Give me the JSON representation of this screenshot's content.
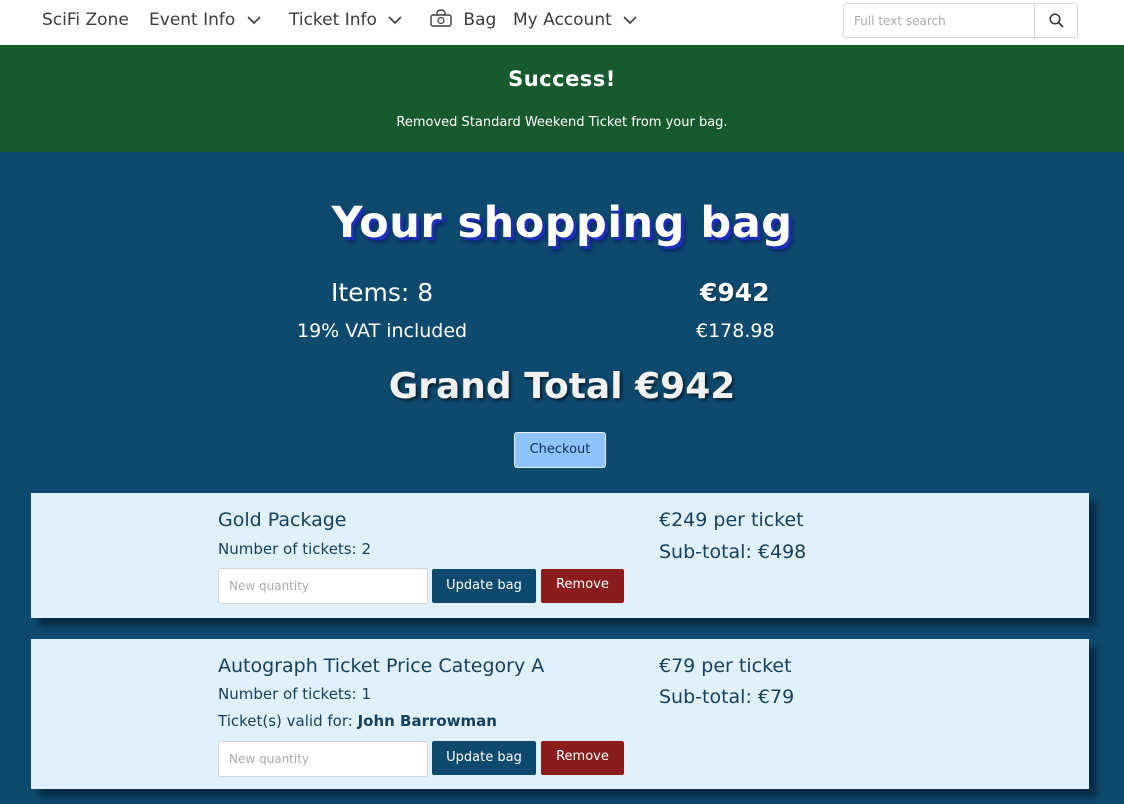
{
  "nav": {
    "brand": "SciFi Zone",
    "event_info": "Event Info",
    "ticket_info": "Ticket Info",
    "bag": "Bag",
    "my_account": "My Account",
    "search_placeholder": "Full text search"
  },
  "alert": {
    "title": "Success!",
    "message": "Removed Standard Weekend Ticket from your bag."
  },
  "summary": {
    "title": "Your shopping bag",
    "items_label": "Items: 8",
    "total": "€942",
    "vat_label": "19% VAT included",
    "vat_amount": "€178.98",
    "grand_total": "Grand Total €942",
    "checkout_label": "Checkout"
  },
  "items": [
    {
      "name": "Gold Package",
      "qty_text": "Number of tickets: 2",
      "price": "€249 per ticket",
      "subtotal": "Sub-total: €498",
      "qty_placeholder": "New quantity",
      "update_label": "Update bag",
      "remove_label": "Remove"
    },
    {
      "name": "Autograph Ticket Price Category A",
      "qty_text": "Number of tickets: 1",
      "valid_label": "Ticket(s) valid for:",
      "valid_name": "John Barrowman",
      "price": "€79 per ticket",
      "subtotal": "Sub-total: €79",
      "qty_placeholder": "New quantity",
      "update_label": "Update bag",
      "remove_label": "Remove"
    }
  ],
  "colors": {
    "page_bg": "#0d4a6e",
    "success_bg": "#165a2e",
    "card_bg": "#e0f1fc",
    "checkout_bg": "#8ec3ff",
    "update_bg": "#0e4a6e",
    "remove_bg": "#8a1c1c"
  },
  "icons": {
    "chevron": "chevron-down-icon",
    "bag": "shopping-bag-icon",
    "search": "search-icon"
  }
}
